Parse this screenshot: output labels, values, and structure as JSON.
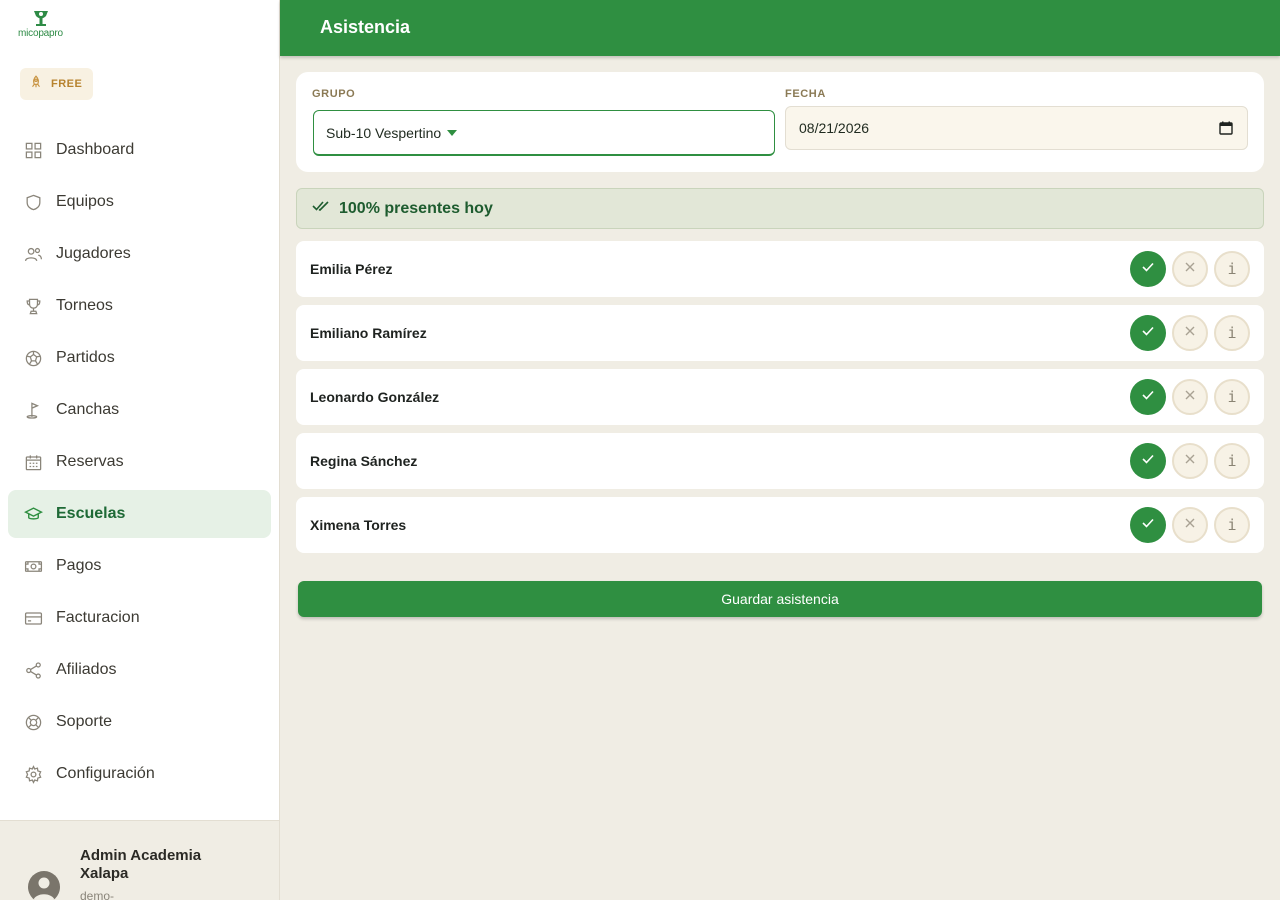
{
  "brand": {
    "logo_text": "micopapro",
    "plan_badge": "FREE"
  },
  "sidebar": {
    "items": [
      {
        "label": "Dashboard",
        "icon": "grid-icon",
        "active": false
      },
      {
        "label": "Equipos",
        "icon": "shield-icon",
        "active": false
      },
      {
        "label": "Jugadores",
        "icon": "users-icon",
        "active": false
      },
      {
        "label": "Torneos",
        "icon": "trophy-icon",
        "active": false
      },
      {
        "label": "Partidos",
        "icon": "soccer-ball-icon",
        "active": false
      },
      {
        "label": "Canchas",
        "icon": "golf-flag-icon",
        "active": false
      },
      {
        "label": "Reservas",
        "icon": "calendar-icon",
        "active": false
      },
      {
        "label": "Escuelas",
        "icon": "graduation-cap-icon",
        "active": true
      },
      {
        "label": "Pagos",
        "icon": "banknote-icon",
        "active": false
      },
      {
        "label": "Facturacion",
        "icon": "credit-card-icon",
        "active": false
      },
      {
        "label": "Afiliados",
        "icon": "share-icon",
        "active": false
      },
      {
        "label": "Soporte",
        "icon": "lifebuoy-icon",
        "active": false
      },
      {
        "label": "Configuración",
        "icon": "gear-icon",
        "active": false
      }
    ]
  },
  "user": {
    "name": "Admin Academia Xalapa",
    "subtitle": "demo-"
  },
  "header": {
    "title": "Asistencia"
  },
  "filters": {
    "group_label": "GRUPO",
    "group_value": "Sub-10 Vespertino",
    "date_label": "FECHA",
    "date_value": "08/21/2026"
  },
  "summary": {
    "text": "100% presentes hoy"
  },
  "roster": [
    {
      "name": "Emilia Pérez",
      "status": "present"
    },
    {
      "name": "Emiliano Ramírez",
      "status": "present"
    },
    {
      "name": "Leonardo González",
      "status": "present"
    },
    {
      "name": "Regina Sánchez",
      "status": "present"
    },
    {
      "name": "Ximena Torres",
      "status": "present"
    }
  ],
  "actions": {
    "save_label": "Guardar asistencia",
    "info_glyph": "i"
  },
  "colors": {
    "primary": "#2f8f41",
    "background": "#f0ede4",
    "active_nav_bg": "#e6f1e6",
    "badge_text": "#b7832f"
  }
}
